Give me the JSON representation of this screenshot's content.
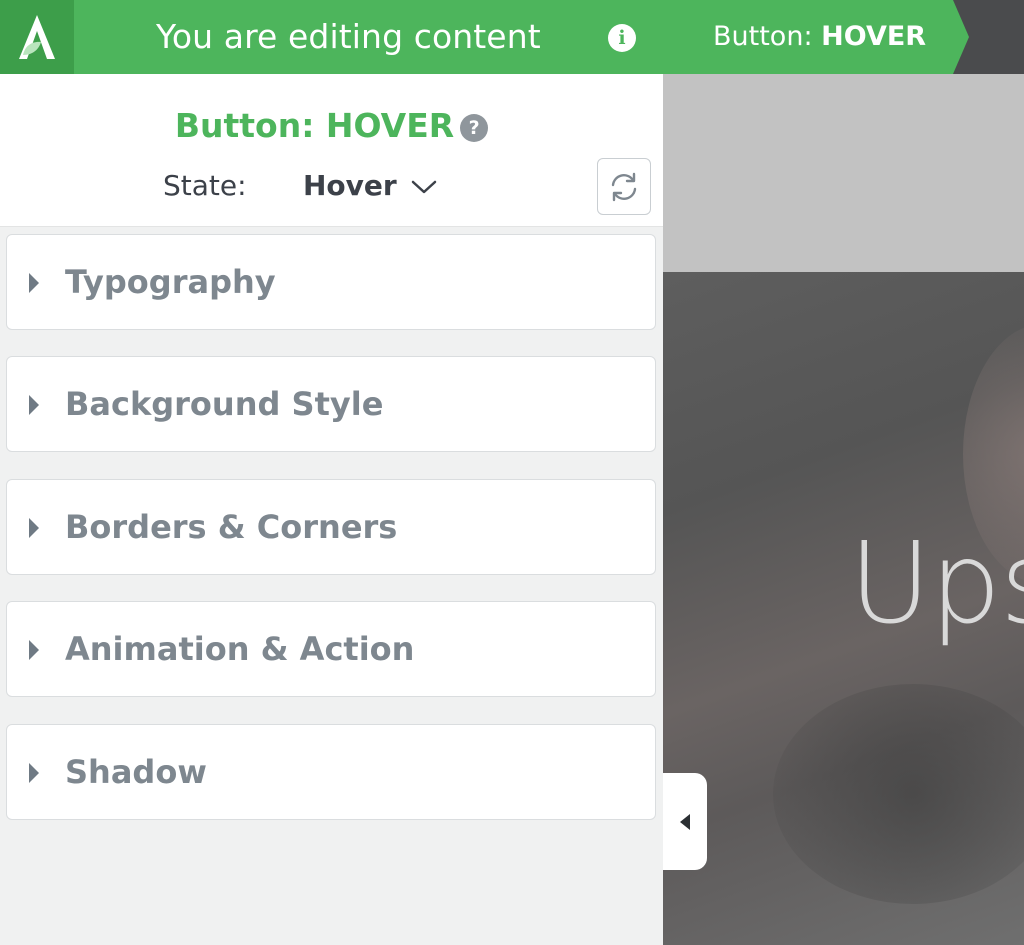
{
  "topbar": {
    "editing_text": "You are editing content",
    "info_icon": "info-icon",
    "breadcrumb_prefix": "Button: ",
    "breadcrumb_state": "HOVER",
    "logo_letter": "A"
  },
  "panel": {
    "title": "Button: HOVER",
    "help_icon": "?",
    "state_label": "State:",
    "state_value": "Hover",
    "sections": [
      {
        "label": "Typography"
      },
      {
        "label": "Background Style"
      },
      {
        "label": "Borders & Corners"
      },
      {
        "label": "Animation & Action"
      },
      {
        "label": "Shadow"
      }
    ]
  },
  "preview": {
    "hero_text": "Ups"
  },
  "colors": {
    "accent": "#4db55c",
    "logo_bg": "#3d9e4a",
    "topbar_dark": "#4a4b4d",
    "section_label": "#7e878f"
  }
}
